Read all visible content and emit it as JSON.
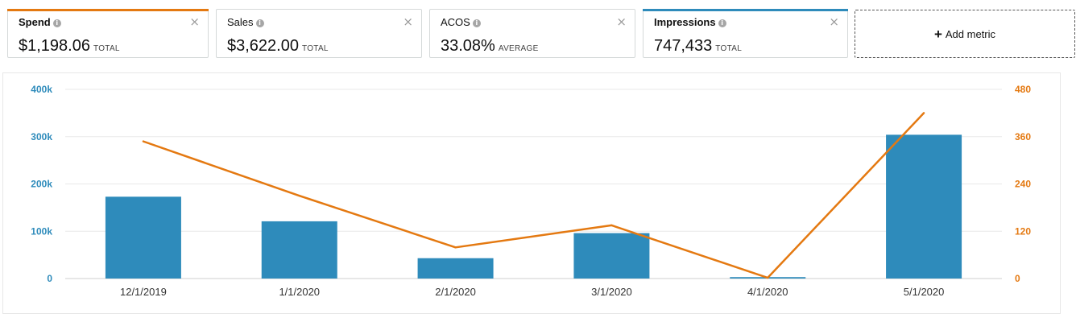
{
  "metrics": [
    {
      "label": "Spend",
      "value": "$1,198.06",
      "suffix": "TOTAL",
      "accent": "#e47911",
      "bold": true
    },
    {
      "label": "Sales",
      "value": "$3,622.00",
      "suffix": "TOTAL",
      "accent": null,
      "bold": false
    },
    {
      "label": "ACOS",
      "value": "33.08%",
      "suffix": "AVERAGE",
      "accent": null,
      "bold": false
    },
    {
      "label": "Impressions",
      "value": "747,433",
      "suffix": "TOTAL",
      "accent": "#2e8bbb",
      "bold": true
    }
  ],
  "add_metric": {
    "label": "Add metric"
  },
  "icons": {
    "info": "info-icon",
    "close": "close-icon",
    "add": "plus-icon"
  },
  "colors": {
    "impressions": "#2e8bbb",
    "spend": "#e47911",
    "grid": "#e8e8e8",
    "text": "#444444"
  },
  "chart_data": {
    "type": "bar",
    "categories": [
      "12/1/2019",
      "1/1/2020",
      "2/1/2020",
      "3/1/2020",
      "4/1/2020",
      "5/1/2020"
    ],
    "series": [
      {
        "values": [
          173000,
          121000,
          43000,
          96000,
          3000,
          304000
        ],
        "axis": "left",
        "type": "bar",
        "color": "#2e8bbb"
      },
      {
        "values": [
          348,
          210,
          79,
          135,
          2,
          420
        ],
        "axis": "right",
        "type": "line",
        "color": "#e47911"
      }
    ],
    "left_axis": {
      "ticks": [
        "0",
        "100k",
        "200k",
        "300k",
        "400k"
      ],
      "range": [
        0,
        400000
      ]
    },
    "right_axis": {
      "ticks": [
        "0",
        "120",
        "240",
        "360",
        "480"
      ],
      "range": [
        0,
        480
      ]
    },
    "grid": true
  }
}
